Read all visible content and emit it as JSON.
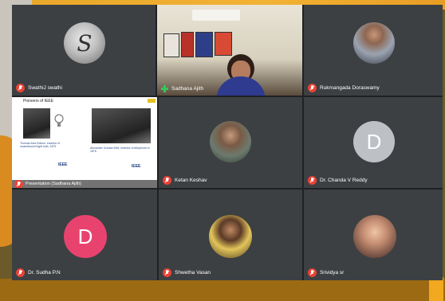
{
  "participants": [
    {
      "id": "swathi",
      "name": "SwathiJ swathi",
      "avatar": "monogram-image"
    },
    {
      "id": "sadhana",
      "name": "Sadhana Ajith",
      "video": "webcam"
    },
    {
      "id": "rukmangada",
      "name": "Rukmangada Doraswamy",
      "avatar": "photo"
    },
    {
      "id": "presenter",
      "name": "Presentation (Sadhana Ajith)",
      "video": "screen-share"
    },
    {
      "id": "ketan",
      "name": "Ketan Keshav",
      "avatar": "photo"
    },
    {
      "id": "chanda",
      "name": "Dr. Chanda V Reddy",
      "avatar_letter": "D",
      "avatar_color": "#bdc1c6"
    },
    {
      "id": "sudha",
      "name": "Dr. Sudha P.N",
      "avatar_letter": "D",
      "avatar_color": "#e8436e"
    },
    {
      "id": "shwetha",
      "name": "Shwetha Vasan",
      "avatar": "photo"
    },
    {
      "id": "srividya",
      "name": "Srividya sr",
      "avatar": "photo"
    }
  ],
  "slide": {
    "title": "Pioneers of IEEE",
    "caption_left": "Thomas Alva Edison, inventor of incandescent light bulb, 1879",
    "caption_right": "Alexander Graham Bell, inventor of telephone in 1876",
    "brand": "IEEE"
  },
  "colors": {
    "tile_bg": "#3c4043",
    "window_bg": "#202124",
    "mic_muted": "#ea4335"
  }
}
